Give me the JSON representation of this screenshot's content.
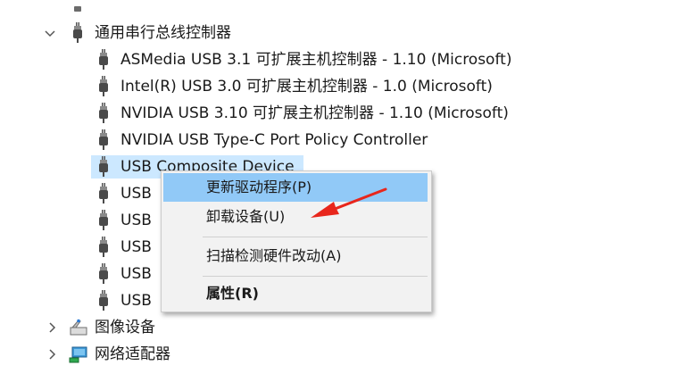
{
  "tree": {
    "usb_controllers": {
      "label": "通用串行总线控制器",
      "expanded": true,
      "children": [
        {
          "label": "ASMedia USB 3.1 可扩展主机控制器 - 1.10 (Microsoft)"
        },
        {
          "label": "Intel(R) USB 3.0 可扩展主机控制器 - 1.0 (Microsoft)"
        },
        {
          "label": "NVIDIA USB 3.10 可扩展主机控制器 - 1.10 (Microsoft)"
        },
        {
          "label": "NVIDIA USB Type-C Port Policy Controller"
        },
        {
          "label": "USB Composite Device",
          "selected": true
        },
        {
          "label": "USB"
        },
        {
          "label": "USB"
        },
        {
          "label": "USB"
        },
        {
          "label": "USB"
        },
        {
          "label": "USB"
        }
      ]
    },
    "imaging_devices": {
      "label": "图像设备",
      "expanded": false
    },
    "network_adapters": {
      "label": "网络适配器",
      "expanded": false
    }
  },
  "context_menu": {
    "items": [
      {
        "label": "更新驱动程序(P)",
        "highlighted": true
      },
      {
        "label": "卸载设备(U)"
      },
      {
        "label": "扫描检测硬件改动(A)"
      },
      {
        "label": "属性(R)",
        "bold": true
      }
    ]
  },
  "colors": {
    "selection": "#cce8ff",
    "menu_highlight": "#91c9f7",
    "menu_background": "#f2f2f2",
    "annotation_arrow": "#e8261c"
  }
}
